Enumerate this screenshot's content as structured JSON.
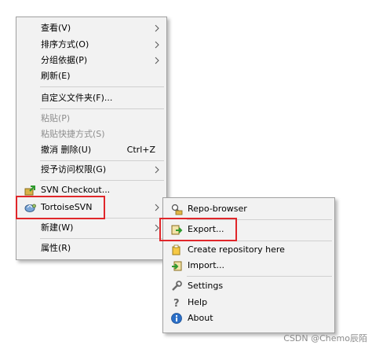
{
  "context_menu": {
    "view": "查看(V)",
    "sort_by": "排序方式(O)",
    "group_by": "分组依据(P)",
    "refresh": "刷新(E)",
    "customize_folder": "自定义文件夹(F)...",
    "paste": "粘贴(P)",
    "paste_shortcut": "粘贴快捷方式(S)",
    "undo_delete": "撤消 删除(U)",
    "undo_shortcut": "Ctrl+Z",
    "give_access": "授予访问权限(G)",
    "svn_checkout": "SVN Checkout...",
    "tortoisesvn": "TortoiseSVN",
    "new": "新建(W)",
    "properties": "属性(R)"
  },
  "submenu": {
    "repo_browser": "Repo-browser",
    "export": "Export...",
    "create_repository": "Create repository here",
    "import": "Import...",
    "settings": "Settings",
    "help": "Help",
    "about": "About"
  },
  "watermark": "CSDN @Chemo辰陌",
  "colors": {
    "menu_background": "#f2f2f2",
    "highlight_border": "#e0262a"
  }
}
